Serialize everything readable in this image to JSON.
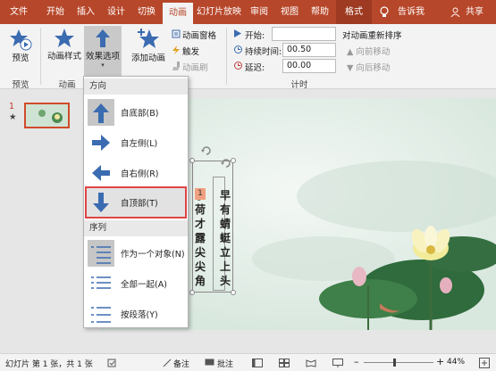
{
  "tabs": [
    "文件",
    "开始",
    "插入",
    "设计",
    "切换",
    "动画",
    "幻灯片放映",
    "审阅",
    "视图",
    "帮助",
    "格式"
  ],
  "tab_extra": {
    "tell": "告诉我",
    "share": "共享"
  },
  "ribbon": {
    "preview": "预览",
    "anim_style": "动画样式",
    "effect_options": "效果选项",
    "add_anim": "添加动画",
    "anim_pane": "动画窗格",
    "trigger": "触发",
    "anim_painter": "动画刷",
    "start_label": "开始:",
    "duration_label": "持续时间:",
    "duration_value": "00.50",
    "delay_label": "延迟:",
    "delay_value": "00.00",
    "reorder": "对动画重新排序",
    "move_earlier": "向前移动",
    "move_later": "向后移动",
    "group_preview": "预览",
    "group_anim": "动画",
    "group_timing": "计时"
  },
  "dropdown": {
    "direction_header": "方向",
    "items": [
      "自底部(B)",
      "自左侧(L)",
      "自右侧(R)",
      "自顶部(T)"
    ],
    "sequence_header": "序列",
    "seq_items": [
      "作为一个对象(N)",
      "全部一起(A)",
      "按段落(Y)"
    ]
  },
  "slide_panel": {
    "number": "1",
    "star": "★"
  },
  "slide": {
    "col1": "小荷才露尖尖角",
    "col2": "早有蜻蜓立上头",
    "tag": "1"
  },
  "status": {
    "slide_info": "幻灯片 第 1 张，共 1 张",
    "notes": "备注",
    "comments": "批注",
    "zoom": "44%"
  }
}
